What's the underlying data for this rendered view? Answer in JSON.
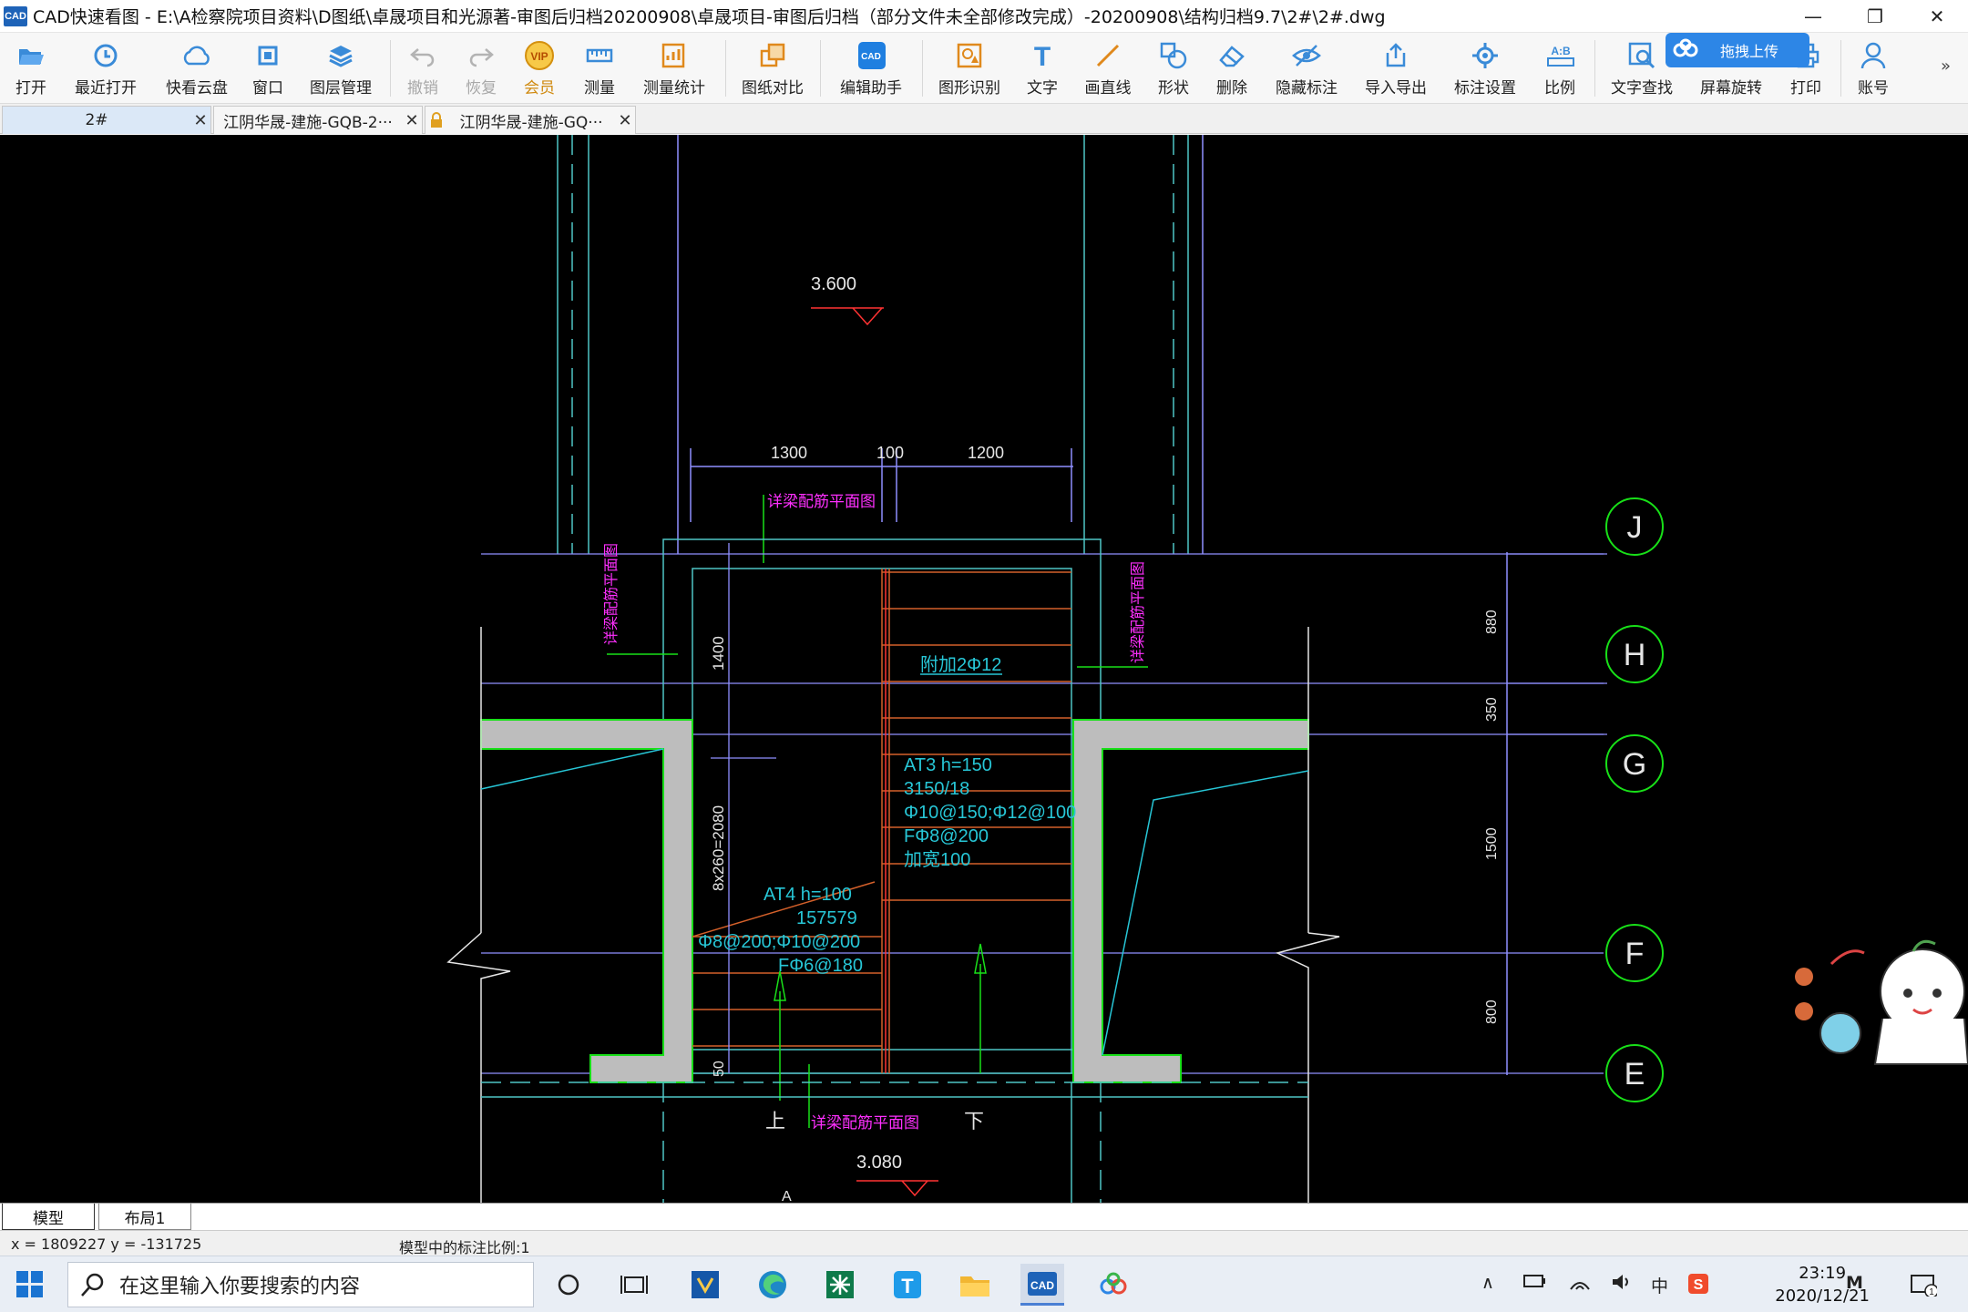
{
  "window": {
    "app_badge": "CAD",
    "title": "CAD快速看图 - E:\\A检察院项目资料\\D图纸\\卓晟项目和光源著-审图后归档20200908\\卓晟项目-审图后归档（部分文件未全部修改完成）-20200908\\结构归档9.7\\2#\\2#.dwg",
    "minimize": "—",
    "restore": "❐",
    "close": "✕"
  },
  "toolbar": {
    "items": [
      {
        "label": "打开",
        "icon": "folder-open-icon"
      },
      {
        "label": "最近打开",
        "icon": "history-icon"
      },
      {
        "label": "快看云盘",
        "icon": "cloud-icon"
      },
      {
        "label": "窗口",
        "icon": "window-icon"
      },
      {
        "label": "图层管理",
        "icon": "layers-icon"
      },
      {
        "label": "撤销",
        "icon": "undo-icon"
      },
      {
        "label": "恢复",
        "icon": "redo-icon"
      },
      {
        "label": "会员",
        "icon": "vip-icon",
        "badge": "VIP"
      },
      {
        "label": "测量",
        "icon": "ruler-icon"
      },
      {
        "label": "测量统计",
        "icon": "measure-stats-icon"
      },
      {
        "label": "图纸对比",
        "icon": "compare-icon"
      },
      {
        "label": "编辑助手",
        "icon": "edit-assistant-icon",
        "badge": "CAD"
      },
      {
        "label": "图形识别",
        "icon": "shape-recognize-icon"
      },
      {
        "label": "文字",
        "icon": "text-icon",
        "glyph": "T"
      },
      {
        "label": "画直线",
        "icon": "line-icon"
      },
      {
        "label": "形状",
        "icon": "shapes-icon"
      },
      {
        "label": "删除",
        "icon": "eraser-icon"
      },
      {
        "label": "隐藏标注",
        "icon": "hide-icon"
      },
      {
        "label": "导入导出",
        "icon": "import-export-icon"
      },
      {
        "label": "标注设置",
        "icon": "annotation-settings-icon"
      },
      {
        "label": "比例",
        "icon": "scale-icon",
        "glyph": "A:B"
      },
      {
        "label": "文字查找",
        "icon": "text-search-icon"
      },
      {
        "label": "屏幕旋转",
        "icon": "rotate-icon"
      },
      {
        "label": "打印",
        "icon": "print-icon"
      },
      {
        "label": "账号",
        "icon": "user-icon"
      }
    ],
    "upload_badge": "拖拽上传",
    "more": "»"
  },
  "tabs": [
    {
      "label": "2#",
      "close": "✕"
    },
    {
      "label": "江阴华晟-建施-GQB-2···",
      "close": "✕"
    },
    {
      "label": "江阴华晟-建施-GQ···",
      "close": "✕"
    }
  ],
  "drawing": {
    "elev_top": "3.600",
    "elev_bottom": "3.080",
    "dim_1300": "1300",
    "dim_100": "100",
    "dim_1200": "1200",
    "dim_1400": "1400",
    "dim_8x260": "8x260=2080",
    "dim_50": "50",
    "dim_880": "880",
    "dim_350": "350",
    "dim_1500": "1500",
    "dim_800": "800",
    "ref_top": "详梁配筋平面图",
    "ref_left": "详梁配筋平面图",
    "ref_right": "详梁配筋平面图",
    "ref_bottom": "详梁配筋平面图",
    "extra_bar": "附加2Φ12",
    "at3_1": "AT3  h=150",
    "at3_2": "3150/18",
    "at3_3": "Φ10@150;Φ12@100",
    "at3_4": "FΦ8@200",
    "at3_5": "加宽100",
    "at4_1": "AT4  h=100",
    "at4_2": "157579",
    "at4_3": "Φ8@200;Φ10@200",
    "at4_4": "FΦ6@180",
    "up": "上",
    "down": "下",
    "grid_J": "J",
    "grid_H": "H",
    "grid_G": "G",
    "grid_F": "F",
    "grid_E": "E",
    "grid_A": "A"
  },
  "sheet_tabs": {
    "model": "模型",
    "layout": "布局1"
  },
  "status": {
    "coords": "x = 1809227  y = -131725",
    "scale": "模型中的标注比例:1"
  },
  "taskbar": {
    "search_placeholder": "在这里输入你要搜索的内容",
    "time": "23:19",
    "date": "2020/12/21",
    "ime": "中",
    "notification_count": "1"
  },
  "colors": {
    "canvas_bg": "#000000",
    "dim_line": "#8f8fff",
    "axis_line": "#5ad0d0",
    "grid_bubble": "#18e018",
    "rebar_text": "#27c6d6",
    "ref_text": "#ff2fff",
    "stair_line": "#d4602a",
    "wall_fill": "#bdbdbd",
    "wall_edge": "#19e019"
  }
}
